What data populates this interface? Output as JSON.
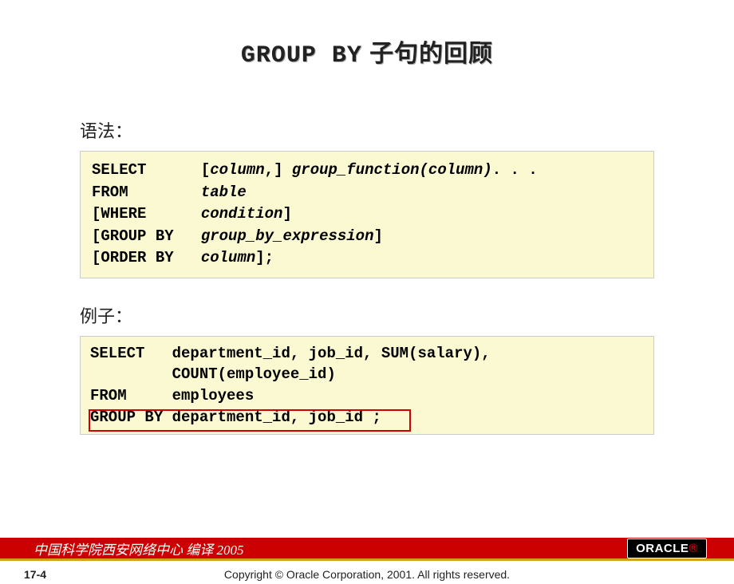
{
  "title": {
    "mono": "GROUP BY",
    "cn": " 子句的回顾"
  },
  "syntax": {
    "label": "语法：",
    "line1_kw": "SELECT",
    "line1_br": "[",
    "line1_it1": "column",
    "line1_cm": ",]",
    "line1_it2": " group_function(column)",
    "line1_end": ". . .",
    "line2_kw": "FROM",
    "line2_it": "table",
    "line3_kw": "[WHERE",
    "line3_it": "condition",
    "line3_br": "]",
    "line4_kw": "[GROUP BY",
    "line4_it": "group_by_expression",
    "line4_br": "]",
    "line5_kw": "[ORDER BY",
    "line5_it": "column",
    "line5_br": "];"
  },
  "example": {
    "label": "例子：",
    "line1": "SELECT   department_id, job_id, SUM(salary),",
    "line2": "         COUNT(employee_id)",
    "line3": "FROM     employees",
    "line4": "GROUP BY department_id, job_id ;"
  },
  "footer": {
    "translator": "中国科学院西安网络中心 编译 2005",
    "oracle": "ORACLE",
    "copyright": "Copyright © Oracle Corporation, 2001. All rights reserved.",
    "page": "17-4"
  }
}
